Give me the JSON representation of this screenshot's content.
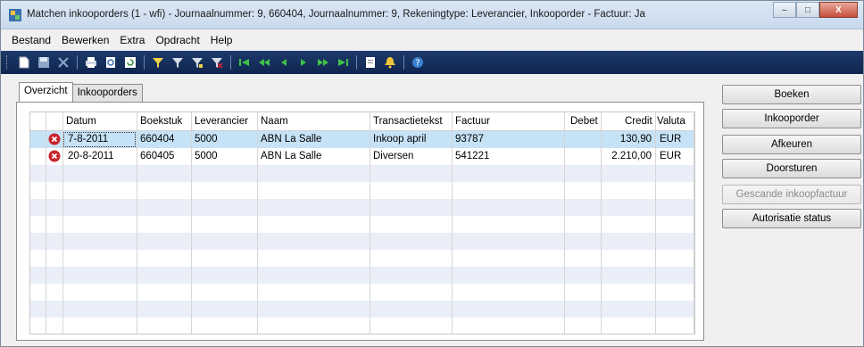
{
  "window": {
    "title": "Matchen inkooporders (1 - wfi) - Journaalnummer: 9, 660404, Journaalnummer: 9, Rekeningtype: Leverancier, Inkooporder - Factuur: Ja",
    "minimize_glyph": "–",
    "maximize_glyph": "□",
    "close_glyph": "X"
  },
  "menu": [
    "Bestand",
    "Bewerken",
    "Extra",
    "Opdracht",
    "Help"
  ],
  "toolbar": {
    "icons": [
      "new-icon",
      "save-icon",
      "delete-icon",
      "print-icon",
      "print-preview-icon",
      "refresh-icon",
      "filter-icon",
      "filter-by-field-icon",
      "filter-by-selection-icon",
      "remove-filter-icon",
      "first-record-icon",
      "previous-page-icon",
      "previous-record-icon",
      "next-record-icon",
      "next-page-icon",
      "last-record-icon",
      "document-handling-icon",
      "alert-icon",
      "help-icon"
    ]
  },
  "tabs": [
    "Overzicht",
    "Inkooporders"
  ],
  "grid": {
    "headers": {
      "datum": "Datum",
      "boekstuk": "Boekstuk",
      "leverancier": "Leverancier",
      "naam": "Naam",
      "transactietekst": "Transactietekst",
      "factuur": "Factuur",
      "debet": "Debet",
      "credit": "Credit",
      "valuta": "Valuta"
    },
    "rows": [
      {
        "datum": "7-8-2011",
        "boekstuk": "660404",
        "leverancier": "5000",
        "naam": "ABN La Salle",
        "transactietekst": "Inkoop april",
        "factuur": "93787",
        "debet": "",
        "credit": "130,90",
        "valuta": "EUR"
      },
      {
        "datum": "20-8-2011",
        "boekstuk": "660405",
        "leverancier": "5000",
        "naam": "ABN La Salle",
        "transactietekst": "Diversen",
        "factuur": "541221",
        "debet": "",
        "credit": "2.210,00",
        "valuta": "EUR"
      }
    ]
  },
  "buttons": {
    "boeken": "Boeken",
    "inkooporder": "Inkooporder",
    "afkeuren": "Afkeuren",
    "doorsturen": "Doorsturen",
    "gescande": "Gescande inkoopfactuur",
    "autorisatie": "Autorisatie status"
  },
  "colors": {
    "selected_row": "#c6e2f6",
    "alt_row": "#eaeef8",
    "toolbar_bg": "#1d3a6a",
    "error_icon": "#c8242b"
  }
}
